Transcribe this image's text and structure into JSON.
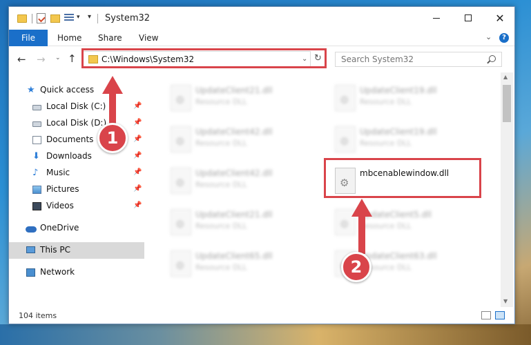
{
  "window": {
    "title": "System32",
    "qa_dropdown": "▾",
    "qa_customize": "▾",
    "minimize_label": "",
    "close_glyph": "✕"
  },
  "ribbon": {
    "tabs": [
      {
        "label": "File"
      },
      {
        "label": "Home"
      },
      {
        "label": "Share"
      },
      {
        "label": "View"
      }
    ],
    "expand_glyph": "⌄",
    "help_glyph": "?"
  },
  "nav": {
    "back_glyph": "←",
    "forward_glyph": "→",
    "recent_glyph": "⌄",
    "up_glyph": "↑",
    "address": "C:\\Windows\\System32",
    "address_dropdown": "⌄",
    "refresh_glyph": "↻",
    "search_placeholder": "Search System32"
  },
  "sidebar": {
    "items": [
      {
        "label": "Quick access",
        "icon": "star-icon"
      },
      {
        "label": "Local Disk (C:)",
        "icon": "drive-icon",
        "pinned": true
      },
      {
        "label": "Local Disk (D:)",
        "icon": "drive-icon",
        "pinned": true
      },
      {
        "label": "Documents",
        "icon": "documents-icon",
        "pinned": true
      },
      {
        "label": "Downloads",
        "icon": "download-icon",
        "pinned": true
      },
      {
        "label": "Music",
        "icon": "music-icon",
        "pinned": true
      },
      {
        "label": "Pictures",
        "icon": "pictures-icon",
        "pinned": true
      },
      {
        "label": "Videos",
        "icon": "videos-icon",
        "pinned": true
      },
      {
        "label": "OneDrive",
        "icon": "cloud-icon"
      },
      {
        "label": "This PC",
        "icon": "computer-icon",
        "selected": true
      },
      {
        "label": "Network",
        "icon": "network-icon"
      }
    ],
    "pin_glyph": "📌"
  },
  "files": [
    {
      "name": "UpdateClient21.dll",
      "type": "Resource DLL"
    },
    {
      "name": "UpdateClient19.dll",
      "type": "Resource DLL"
    },
    {
      "name": "UpdateClient42.dll",
      "type": "Resource DLL"
    },
    {
      "name": "UpdateClient19.dll",
      "type": "Resource DLL"
    },
    {
      "name": "UpdateClient42.dll",
      "type": "Resource DLL"
    },
    {
      "name": "mbcenablewindow.dll",
      "type": ""
    },
    {
      "name": "UpdateClient21.dll",
      "type": "Resource DLL"
    },
    {
      "name": "UpdateClient5.dll",
      "type": "Resource DLL"
    },
    {
      "name": "UpdateClient65.dll",
      "type": "Resource DLL"
    },
    {
      "name": "UpdateClient63.dll",
      "type": "Resource DLL"
    }
  ],
  "scrollbar": {
    "up_glyph": "▲",
    "down_glyph": "▼"
  },
  "status": {
    "item_count": "104 items"
  },
  "annotations": {
    "step1": "1",
    "step2": "2",
    "accent": "#d9444a"
  }
}
